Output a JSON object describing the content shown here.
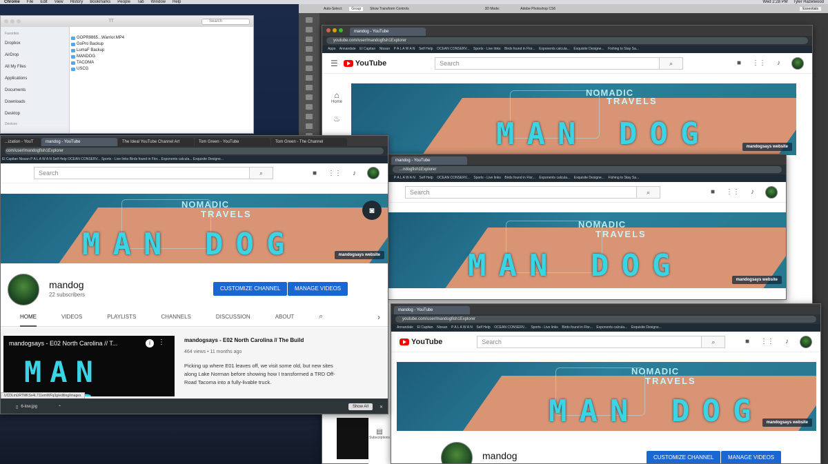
{
  "menubar": {
    "app": "Chrome",
    "items": [
      "File",
      "Edit",
      "View",
      "History",
      "Bookmarks",
      "People",
      "Tab",
      "Window",
      "Help"
    ],
    "clock": "Wed 2:28 PM",
    "user": "Tyler Hazelwood"
  },
  "finder": {
    "title": "TT",
    "search_placeholder": "Search",
    "favorites_label": "Favorites",
    "devices_label": "Devices",
    "sidebar": [
      "Dropbox",
      "AirDrop",
      "All My Files",
      "Applications",
      "Documents",
      "Downloads",
      "Desktop"
    ],
    "files": [
      "GOPR9865...Warrior.MP4",
      "GoPro Backup",
      "LumaF Backup",
      "MANDOG",
      "TACOMA",
      "USCG"
    ]
  },
  "photoshop": {
    "title": "Adobe Photoshop CS6",
    "auto_select": "Auto-Select:",
    "group": "Group",
    "transform": "Show Transform Controls",
    "workspace": "Essentials",
    "mode": "3D Mode:"
  },
  "bookmarks": [
    "Apps",
    "Annandale",
    "El Capitan",
    "Nissan",
    "P A L A W A N",
    "Self Help",
    "OCEAN CONSERV...",
    "Sports - Live links",
    "Birds found in Flor...",
    "Exponents calcula...",
    "Exquisite Designe...",
    "Fishing to Stay Sa..."
  ],
  "yt": {
    "tab_title": "mandog - YouTube",
    "url": "youtube.com/user/mandogfish1Explorer",
    "search_placeholder": "Search",
    "logo": "YouTube",
    "home_label": "Home",
    "subs_label": "Subscriptions",
    "banner": {
      "nomadic": "NOMADIC",
      "travels": "TRAVELS",
      "mandog": "MAN DOG",
      "site_link": "mandogsays website"
    },
    "channel_name": "mandog",
    "subscribers": "22 subscribers",
    "customize": "CUSTOMIZE CHANNEL",
    "manage": "MANAGE VIDEOS",
    "tabs": [
      "HOME",
      "VIDEOS",
      "PLAYLISTS",
      "CHANNELS",
      "DISCUSSION",
      "ABOUT"
    ],
    "video": {
      "thumb_title": "mandogsays - E02 North Carolina // T...",
      "thumb_logo": "MAN DOG",
      "title": "mandogsays - E02 North Carolina // The Build",
      "meta": "464 views • 11 months ago",
      "desc": "Picking up where E01 leaves off, we visit some old, but new sites along Lake Norman before showing how I transformed a TRD Off-Road Tacoma into a fully-livable truck."
    },
    "status_url": "UCDLmURTMKSv4L711emWFq3g/editing/images"
  },
  "front_tabs": [
    "...ization - YouT",
    "mandog - YouTube",
    "The Ideal YouTube Channel Art",
    "Tom Green - YouTube",
    "Tom Green - The Channel"
  ],
  "front_url": "com/user/mandogfish1Explorer",
  "front_bookmarks": "El Capitan   Nissan   P A L A W A N   Self Help   OCEAN CONSERV...   Sports - Live links   Birds found in Flor...   Exponents calcula...   Exquisite Designe...",
  "download": {
    "file": "6-low.jpg",
    "show_all": "Show All"
  },
  "mid_url": "...ndogfish1Explorer"
}
